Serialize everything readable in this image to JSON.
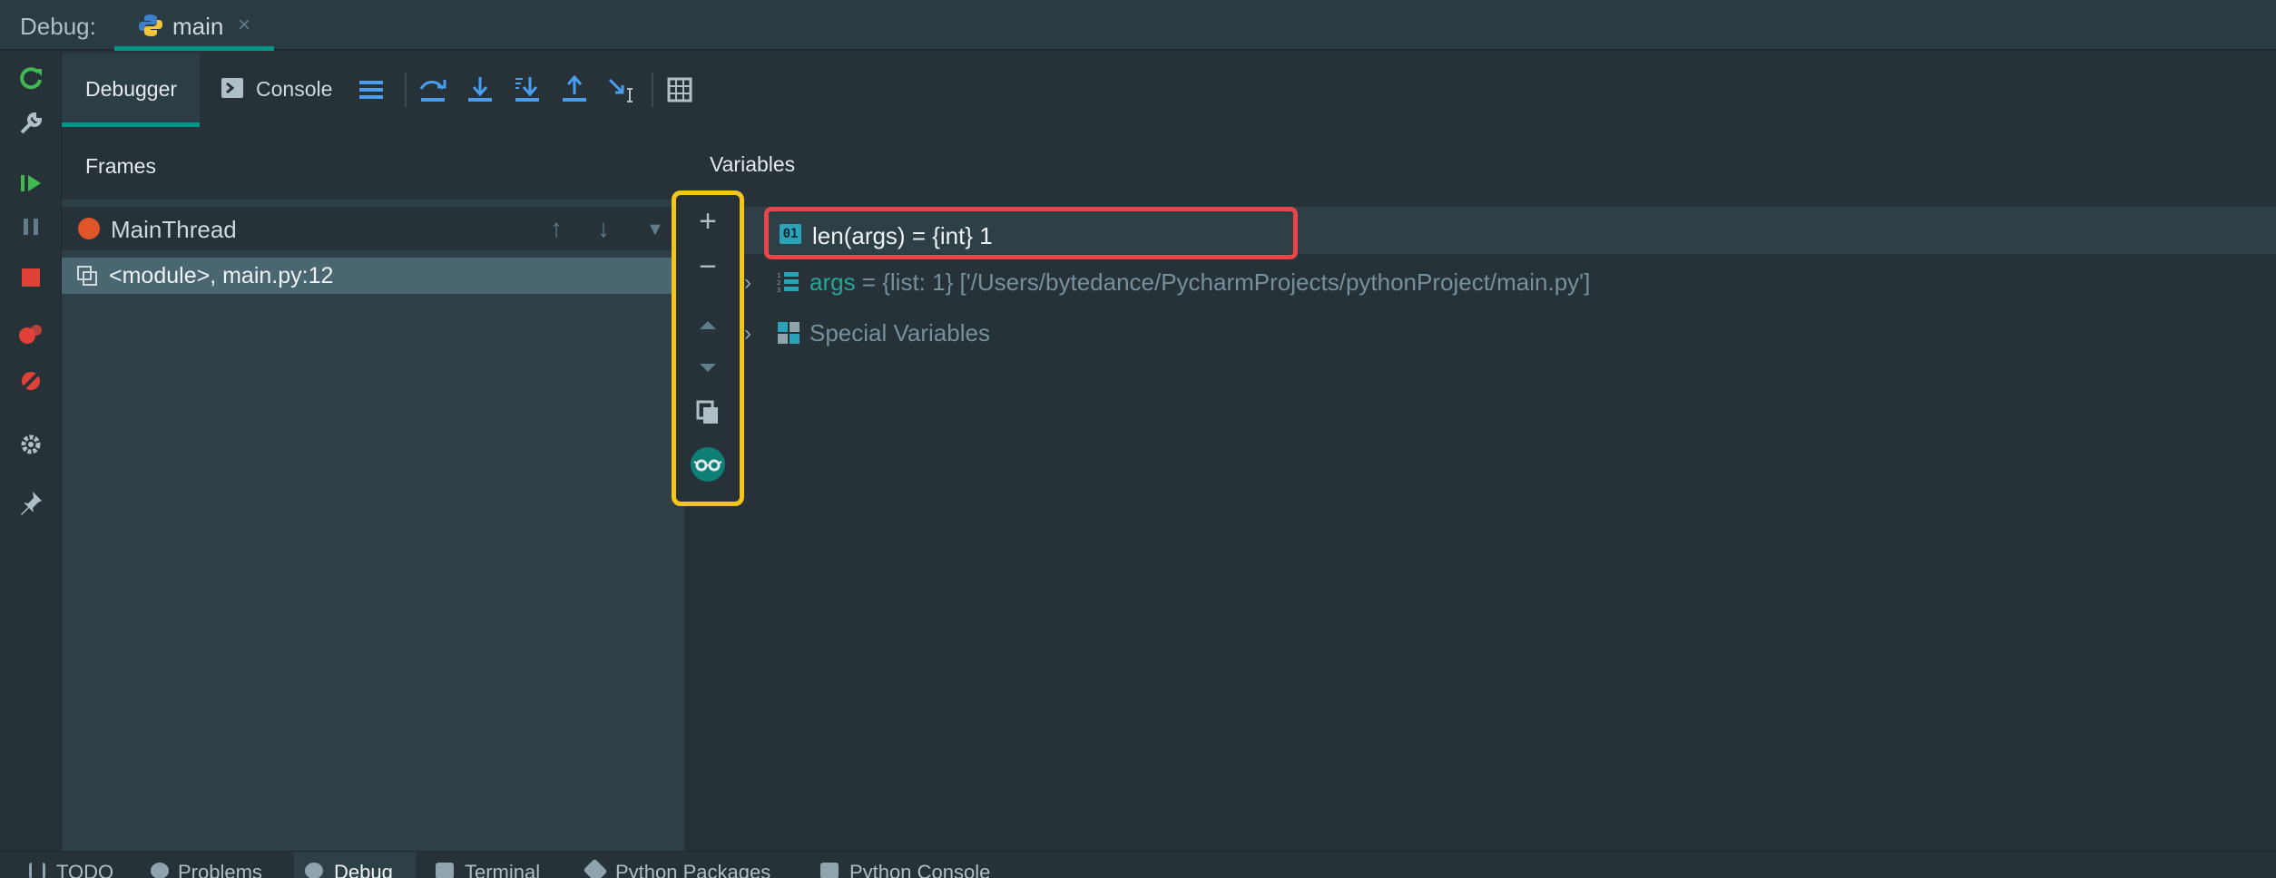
{
  "titlebar": {
    "label": "Debug:",
    "tab": "main",
    "close": "×"
  },
  "toolbar": {
    "debugger_tab": "Debugger",
    "console_tab": "Console"
  },
  "frames": {
    "header": "Frames",
    "thread": "MainThread",
    "frame": "<module>, main.py:12"
  },
  "variables": {
    "header": "Variables",
    "watch_icon": "01",
    "watch": "len(args) = {int} 1",
    "args_name": "args",
    "args_value": " = {list: 1} ['/Users/bytedance/PycharmProjects/pythonProject/main.py']",
    "special": "Special Variables"
  },
  "bottombar": {
    "items": [
      "TODO",
      "Problems",
      "Debug",
      "Terminal",
      "Python Packages",
      "Python Console"
    ],
    "active": "Debug"
  },
  "colors": {
    "accent": "#009688",
    "watch_highlight": "#e8464a",
    "watch_toolbar_highlight": "#f5c518"
  }
}
